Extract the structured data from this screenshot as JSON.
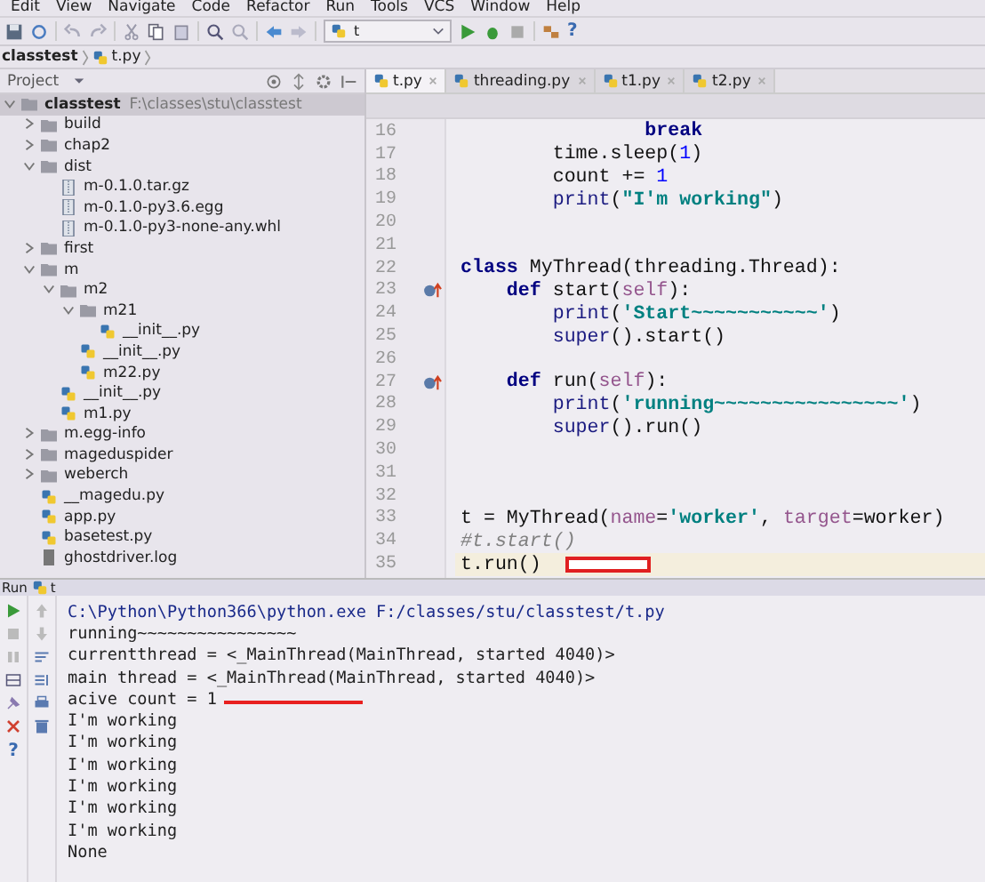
{
  "menu": [
    "Edit",
    "View",
    "Navigate",
    "Code",
    "Refactor",
    "Run",
    "Tools",
    "VCS",
    "Window",
    "Help"
  ],
  "toolbar": {
    "run_config": "t",
    "help": "?"
  },
  "breadcrumb": [
    "classtest",
    "t.py"
  ],
  "project": {
    "title": "Project",
    "tree": [
      {
        "name": "classtest",
        "path": "F:\\classes\\stu\\classtest",
        "kind": "folder",
        "expanded": true,
        "selected": true,
        "children": [
          {
            "name": "build",
            "kind": "folder",
            "expanded": false,
            "selected": false
          },
          {
            "name": "chap2",
            "kind": "folder",
            "expanded": false,
            "selected": false
          },
          {
            "name": "dist",
            "kind": "folder",
            "expanded": true,
            "selected": false,
            "children": [
              {
                "name": "m-0.1.0.tar.gz",
                "kind": "archive",
                "selected": false
              },
              {
                "name": "m-0.1.0-py3.6.egg",
                "kind": "archive",
                "selected": false
              },
              {
                "name": "m-0.1.0-py3-none-any.whl",
                "kind": "archive",
                "selected": false
              }
            ]
          },
          {
            "name": "first",
            "kind": "folder",
            "expanded": false,
            "selected": false
          },
          {
            "name": "m",
            "kind": "folder",
            "expanded": true,
            "selected": false,
            "children": [
              {
                "name": "m2",
                "kind": "folder",
                "expanded": true,
                "selected": false,
                "children": [
                  {
                    "name": "m21",
                    "kind": "folder",
                    "expanded": true,
                    "selected": false,
                    "children": [
                      {
                        "name": "__init__.py",
                        "kind": "python",
                        "selected": false
                      }
                    ]
                  },
                  {
                    "name": "__init__.py",
                    "kind": "python",
                    "selected": false
                  },
                  {
                    "name": "m22.py",
                    "kind": "python",
                    "selected": false
                  }
                ]
              },
              {
                "name": "__init__.py",
                "kind": "python",
                "selected": false
              },
              {
                "name": "m1.py",
                "kind": "python",
                "selected": false
              }
            ]
          },
          {
            "name": "m.egg-info",
            "kind": "folder",
            "expanded": false,
            "selected": false
          },
          {
            "name": "mageduspider",
            "kind": "folder",
            "expanded": false,
            "selected": false
          },
          {
            "name": "weberch",
            "kind": "folder",
            "expanded": false,
            "selected": false
          },
          {
            "name": "__magedu.py",
            "kind": "python",
            "selected": false
          },
          {
            "name": "app.py",
            "kind": "python",
            "selected": false
          },
          {
            "name": "basetest.py",
            "kind": "python",
            "selected": false
          },
          {
            "name": "ghostdriver.log",
            "kind": "log",
            "selected": false
          }
        ]
      }
    ]
  },
  "editor": {
    "tabs": [
      {
        "label": "t.py",
        "selected": true
      },
      {
        "label": "threading.py",
        "selected": false
      },
      {
        "label": "t1.py",
        "selected": false
      },
      {
        "label": "t2.py",
        "selected": false
      }
    ],
    "lines": [
      {
        "number": "16",
        "current": false,
        "marked": false,
        "override": false,
        "tokens": [
          {
            "text": "                break",
            "kind": "kw"
          }
        ]
      },
      {
        "number": "17",
        "current": false,
        "marked": false,
        "override": false,
        "tokens": [
          {
            "text": "        time.sleep(",
            "kind": "plain"
          },
          {
            "text": "1",
            "kind": "num"
          },
          {
            "text": ")",
            "kind": "plain"
          }
        ]
      },
      {
        "number": "18",
        "current": false,
        "marked": false,
        "override": false,
        "tokens": [
          {
            "text": "        count += ",
            "kind": "plain"
          },
          {
            "text": "1",
            "kind": "num"
          }
        ]
      },
      {
        "number": "19",
        "current": false,
        "marked": false,
        "override": false,
        "tokens": [
          {
            "text": "        print",
            "kind": "builtin"
          },
          {
            "text": "(",
            "kind": "plain"
          },
          {
            "text": "\"I'm working\"",
            "kind": "str"
          },
          {
            "text": ")",
            "kind": "plain"
          }
        ]
      },
      {
        "number": "20",
        "current": false,
        "marked": false,
        "override": false
      },
      {
        "number": "21",
        "current": false,
        "marked": false,
        "override": false
      },
      {
        "number": "22",
        "current": false,
        "marked": false,
        "override": false,
        "tokens": [
          {
            "text": "class",
            "kind": "kw"
          },
          {
            "text": " MyThread(threading.Thread):",
            "kind": "plain"
          }
        ]
      },
      {
        "number": "23",
        "current": false,
        "marked": false,
        "override": true,
        "tokens": [
          {
            "text": "    def",
            "kind": "kw"
          },
          {
            "text": " start(",
            "kind": "plain"
          },
          {
            "text": "self",
            "kind": "param"
          },
          {
            "text": "):",
            "kind": "plain"
          }
        ]
      },
      {
        "number": "24",
        "current": false,
        "marked": false,
        "override": false,
        "tokens": [
          {
            "text": "        print",
            "kind": "builtin"
          },
          {
            "text": "(",
            "kind": "plain"
          },
          {
            "text": "'Start~~~~~~~~~~~'",
            "kind": "str"
          },
          {
            "text": ")",
            "kind": "plain"
          }
        ]
      },
      {
        "number": "25",
        "current": false,
        "marked": false,
        "override": false,
        "tokens": [
          {
            "text": "        super",
            "kind": "builtin"
          },
          {
            "text": "().start()",
            "kind": "plain"
          }
        ]
      },
      {
        "number": "26",
        "current": false,
        "marked": false,
        "override": false
      },
      {
        "number": "27",
        "current": false,
        "marked": false,
        "override": true,
        "tokens": [
          {
            "text": "    def",
            "kind": "kw"
          },
          {
            "text": " run(",
            "kind": "plain"
          },
          {
            "text": "self",
            "kind": "param"
          },
          {
            "text": "):",
            "kind": "plain"
          }
        ]
      },
      {
        "number": "28",
        "current": false,
        "marked": false,
        "override": false,
        "tokens": [
          {
            "text": "        print",
            "kind": "builtin"
          },
          {
            "text": "(",
            "kind": "plain"
          },
          {
            "text": "'running~~~~~~~~~~~~~~~~'",
            "kind": "str"
          },
          {
            "text": ")",
            "kind": "plain"
          }
        ]
      },
      {
        "number": "29",
        "current": false,
        "marked": false,
        "override": false,
        "tokens": [
          {
            "text": "        super",
            "kind": "builtin"
          },
          {
            "text": "().run()",
            "kind": "plain"
          }
        ]
      },
      {
        "number": "30",
        "current": false,
        "marked": false,
        "override": false
      },
      {
        "number": "31",
        "current": false,
        "marked": false,
        "override": false
      },
      {
        "number": "32",
        "current": false,
        "marked": false,
        "override": false
      },
      {
        "number": "33",
        "current": false,
        "marked": false,
        "override": false,
        "tokens": [
          {
            "text": "t = MyThread(",
            "kind": "plain"
          },
          {
            "text": "name",
            "kind": "param"
          },
          {
            "text": "=",
            "kind": "plain"
          },
          {
            "text": "'worker'",
            "kind": "str"
          },
          {
            "text": ", ",
            "kind": "plain"
          },
          {
            "text": "target",
            "kind": "param"
          },
          {
            "text": "=worker)",
            "kind": "plain"
          }
        ]
      },
      {
        "number": "34",
        "current": false,
        "marked": false,
        "override": false,
        "tokens": [
          {
            "text": "#t.start()",
            "kind": "comment"
          }
        ]
      },
      {
        "number": "35",
        "current": true,
        "marked": true,
        "override": false,
        "tokens": [
          {
            "text": "t.run()",
            "kind": "plain"
          }
        ]
      }
    ]
  },
  "run": {
    "title": "Run",
    "config": "t",
    "help": "?",
    "output": [
      {
        "kind": "command",
        "text": "C:\\Python\\Python366\\python.exe F:/classes/stu/classtest/t.py",
        "underlined": false
      },
      {
        "kind": "out",
        "text": "running~~~~~~~~~~~~~~~~",
        "underlined": false
      },
      {
        "kind": "out",
        "text": "currentthread = <_MainThread(MainThread, started 4040)>",
        "underlined": false
      },
      {
        "kind": "out",
        "text": "main thread = <_MainThread(MainThread, started 4040)>",
        "underlined": false
      },
      {
        "kind": "out",
        "text": "acive count = 1",
        "underlined": true
      },
      {
        "kind": "out",
        "text": "I'm working",
        "underlined": false
      },
      {
        "kind": "out",
        "text": "I'm working",
        "underlined": false
      },
      {
        "kind": "out",
        "text": "I'm working",
        "underlined": false
      },
      {
        "kind": "out",
        "text": "I'm working",
        "underlined": false
      },
      {
        "kind": "out",
        "text": "I'm working",
        "underlined": false
      },
      {
        "kind": "out",
        "text": "I'm working",
        "underlined": false
      },
      {
        "kind": "out",
        "text": "None",
        "underlined": false
      }
    ]
  }
}
